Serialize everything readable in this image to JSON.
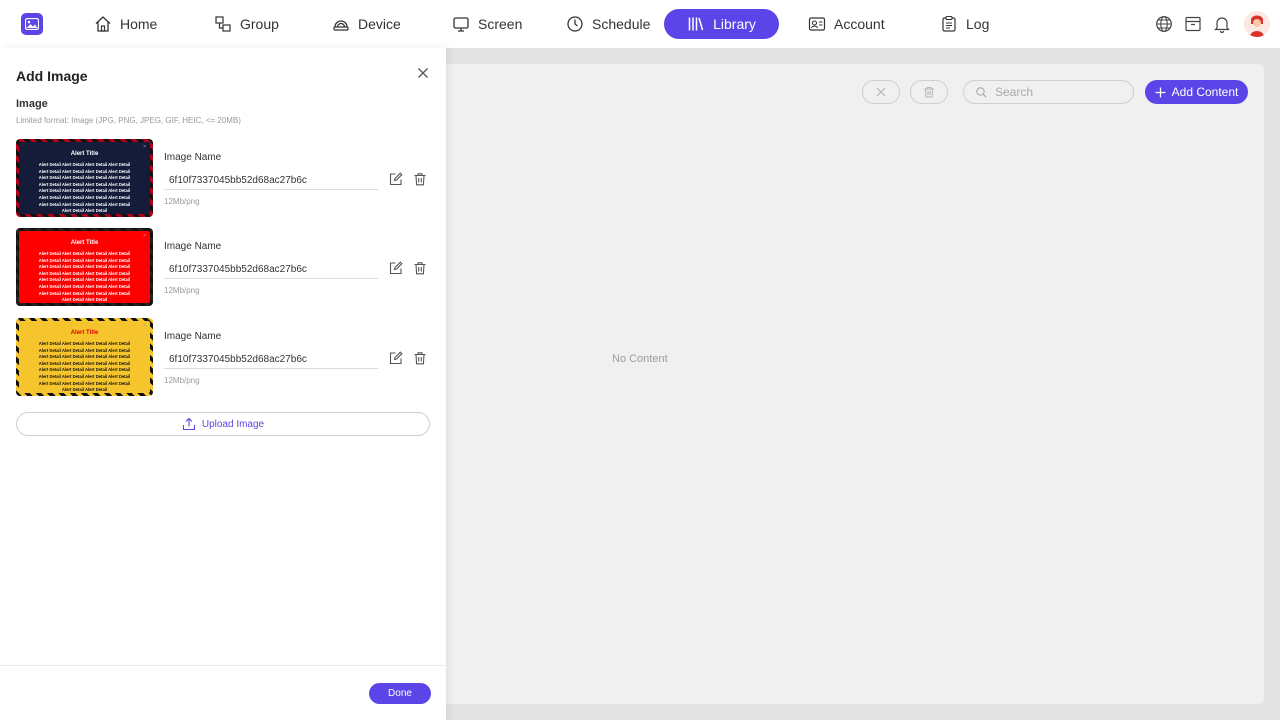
{
  "nav": {
    "items": [
      {
        "label": "Home",
        "icon": "home-icon"
      },
      {
        "label": "Group",
        "icon": "group-icon"
      },
      {
        "label": "Device",
        "icon": "device-icon"
      },
      {
        "label": "Screen",
        "icon": "screen-icon"
      },
      {
        "label": "Schedule",
        "icon": "clock-icon"
      },
      {
        "label": "Library",
        "icon": "library-icon",
        "active": true
      },
      {
        "label": "Account",
        "icon": "account-icon"
      },
      {
        "label": "Log",
        "icon": "log-icon"
      }
    ]
  },
  "library": {
    "search_placeholder": "Search",
    "add_content_label": "Add Content",
    "empty_text": "No Content"
  },
  "drawer": {
    "title": "Add Image",
    "section_label": "Image",
    "hint": "Limited format: Image (JPG, PNG, JPEG, GIF, HEIC, <= 20MB)",
    "images": [
      {
        "label": "Image Name",
        "name": "6f10f7337045bb52d68ac27b6c",
        "meta": "12Mb/png",
        "thumb_title": "Alert Title",
        "thumb_text": "Alert Detail Alert Detail Alert Detail Alert Detail Alert Detail Alert Detail Alert Detail Alert Detail Alert Detail Alert Detail Alert Detail Alert Detail Alert Detail Alert Detail Alert Detail Alert Detail Alert Detail Alert Detail Alert Detail Alert Detail Alert Detail Alert Detail Alert Detail Alert Detail Alert Detail Alert Detail Alert Detail Alert Detail Alert Detail Alert Detail"
      },
      {
        "label": "Image Name",
        "name": "6f10f7337045bb52d68ac27b6c",
        "meta": "12Mb/png",
        "thumb_title": "Alert Title",
        "thumb_text": "Alert Detail Alert Detail Alert Detail Alert Detail Alert Detail Alert Detail Alert Detail Alert Detail Alert Detail Alert Detail Alert Detail Alert Detail Alert Detail Alert Detail Alert Detail Alert Detail Alert Detail Alert Detail Alert Detail Alert Detail Alert Detail Alert Detail Alert Detail Alert Detail Alert Detail Alert Detail Alert Detail Alert Detail Alert Detail Alert Detail"
      },
      {
        "label": "Image Name",
        "name": "6f10f7337045bb52d68ac27b6c",
        "meta": "12Mb/png",
        "thumb_title": "Alert Title",
        "thumb_text": "Alert Detail Alert Detail Alert Detail Alert Detail Alert Detail Alert Detail Alert Detail Alert Detail Alert Detail Alert Detail Alert Detail Alert Detail Alert Detail Alert Detail Alert Detail Alert Detail Alert Detail Alert Detail Alert Detail Alert Detail Alert Detail Alert Detail Alert Detail Alert Detail Alert Detail Alert Detail Alert Detail Alert Detail Alert Detail Alert Detail"
      }
    ],
    "upload_label": "Upload Image",
    "done_label": "Done"
  },
  "colors": {
    "accent": "#5b45e8"
  }
}
